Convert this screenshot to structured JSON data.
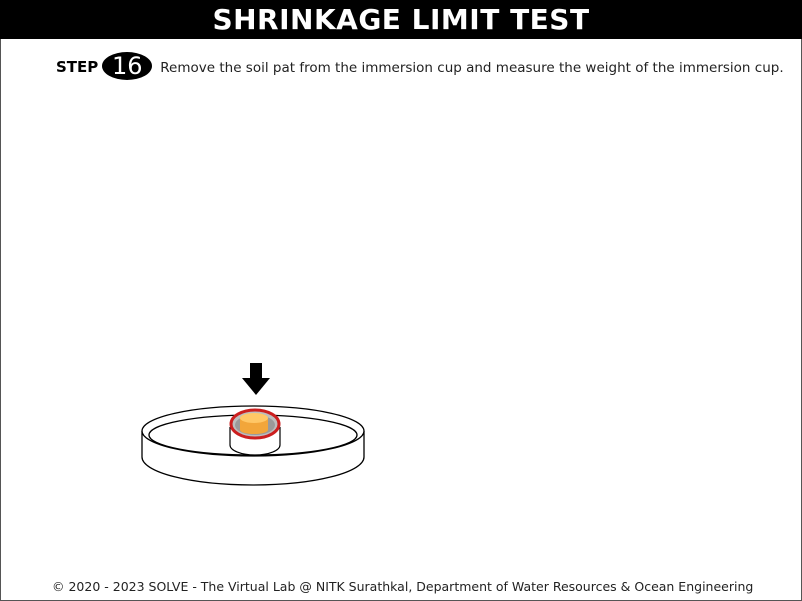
{
  "header": {
    "title": "SHRINKAGE LIMIT TEST"
  },
  "step": {
    "label": "STEP",
    "number": "16",
    "instruction": "Remove the soil pat from the immersion cup and measure the weight of the immersion cup."
  },
  "scene": {
    "items": [
      "down-arrow",
      "evaporating-dish",
      "immersion-cup",
      "soil-pat"
    ],
    "colors": {
      "cup_rim": "#cc1f1f",
      "soil_pat": "#f6b24a",
      "arrow": "#000000"
    }
  },
  "footer": {
    "copyright": "© 2020 - 2023 SOLVE - The Virtual Lab @ NITK Surathkal, Department of Water Resources & Ocean Engineering"
  }
}
